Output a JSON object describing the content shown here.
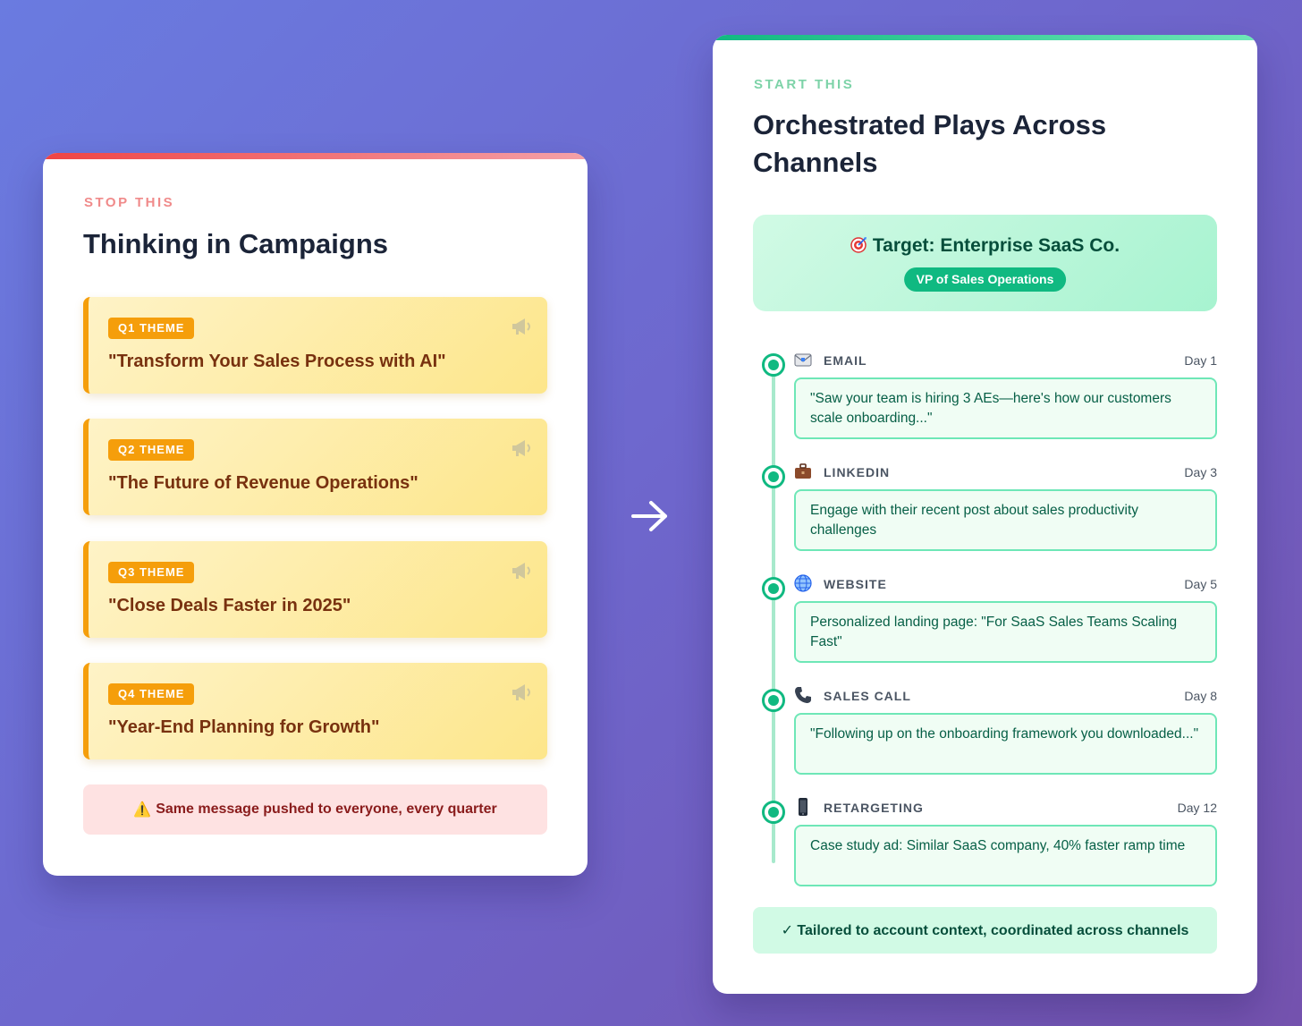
{
  "stop": {
    "eyebrow": "STOP THIS",
    "title": "Thinking in Campaigns",
    "themes": [
      {
        "badge": "Q1 THEME",
        "quote": "\"Transform Your Sales Process with AI\"",
        "icon": "megaphone-icon"
      },
      {
        "badge": "Q2 THEME",
        "quote": "\"The Future of Revenue Operations\"",
        "icon": "megaphone-icon"
      },
      {
        "badge": "Q3 THEME",
        "quote": "\"Close Deals Faster in 2025\"",
        "icon": "megaphone-icon"
      },
      {
        "badge": "Q4 THEME",
        "quote": "\"Year-End Planning for Growth\"",
        "icon": "megaphone-icon"
      }
    ],
    "warning": "Same message pushed to everyone, every quarter",
    "warning_icon": "⚠️"
  },
  "start": {
    "eyebrow": "START THIS",
    "title": "Orchestrated Plays Across Channels",
    "target": {
      "label": "Target: Enterprise SaaS Co.",
      "role": "VP of Sales Operations",
      "icon": "target-icon"
    },
    "steps": [
      {
        "channel": "EMAIL",
        "day": "Day 1",
        "icon": "email-icon",
        "message": "\"Saw your team is hiring 3 AEs—here's how our customers scale onboarding...\""
      },
      {
        "channel": "LINKEDIN",
        "day": "Day 3",
        "icon": "briefcase-icon",
        "message": "Engage with their recent post about sales productivity challenges"
      },
      {
        "channel": "WEBSITE",
        "day": "Day 5",
        "icon": "globe-icon",
        "message": "Personalized landing page: \"For SaaS Sales Teams Scaling Fast\""
      },
      {
        "channel": "SALES CALL",
        "day": "Day 8",
        "icon": "phone-icon",
        "message": "\"Following up on the onboarding framework you downloaded...\""
      },
      {
        "channel": "RETARGETING",
        "day": "Day 12",
        "icon": "mobile-icon",
        "message": "Case study ad: Similar SaaS company, 40% faster ramp time"
      }
    ],
    "summary": "✓ Tailored to account context, coordinated across channels"
  },
  "colors": {
    "stop_accent": "#ef4444",
    "start_accent": "#10b981",
    "theme_accent": "#f59e0b"
  }
}
